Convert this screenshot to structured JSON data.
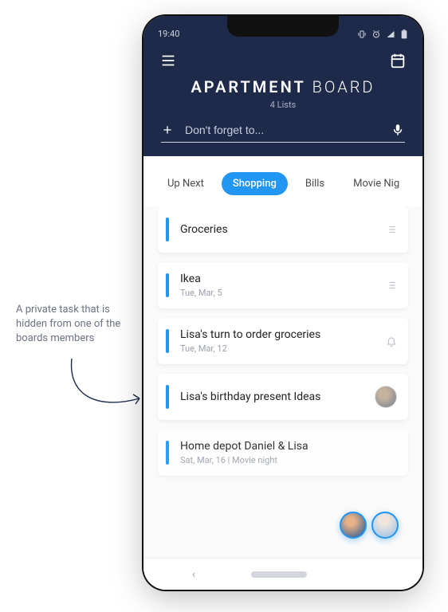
{
  "annotation": {
    "text": "A private task that is hidden from one of the boards members"
  },
  "statusbar": {
    "time": "19:40"
  },
  "header": {
    "title_bold": "APARTMENT",
    "title_light": "BOARD",
    "list_count": "4 Lists",
    "input_placeholder": "Don't forget to..."
  },
  "tabs": [
    {
      "label": "Up Next",
      "active": false
    },
    {
      "label": "Shopping",
      "active": true
    },
    {
      "label": "Bills",
      "active": false
    },
    {
      "label": "Movie Nig",
      "active": false
    }
  ],
  "tasks": [
    {
      "title": "Groceries",
      "subtitle": "",
      "tail": "list"
    },
    {
      "title": "Ikea",
      "subtitle": "Tue, Mar, 5",
      "tail": "list"
    },
    {
      "title": "Lisa's turn to order groceries",
      "subtitle": "Tue, Mar, 12",
      "tail": "bell"
    },
    {
      "title": "Lisa's birthday present Ideas",
      "subtitle": "",
      "tail": "avatar"
    },
    {
      "title": "Home depot Daniel & Lisa",
      "subtitle": "Sat, Mar, 16   | Movie night",
      "tail": ""
    }
  ]
}
